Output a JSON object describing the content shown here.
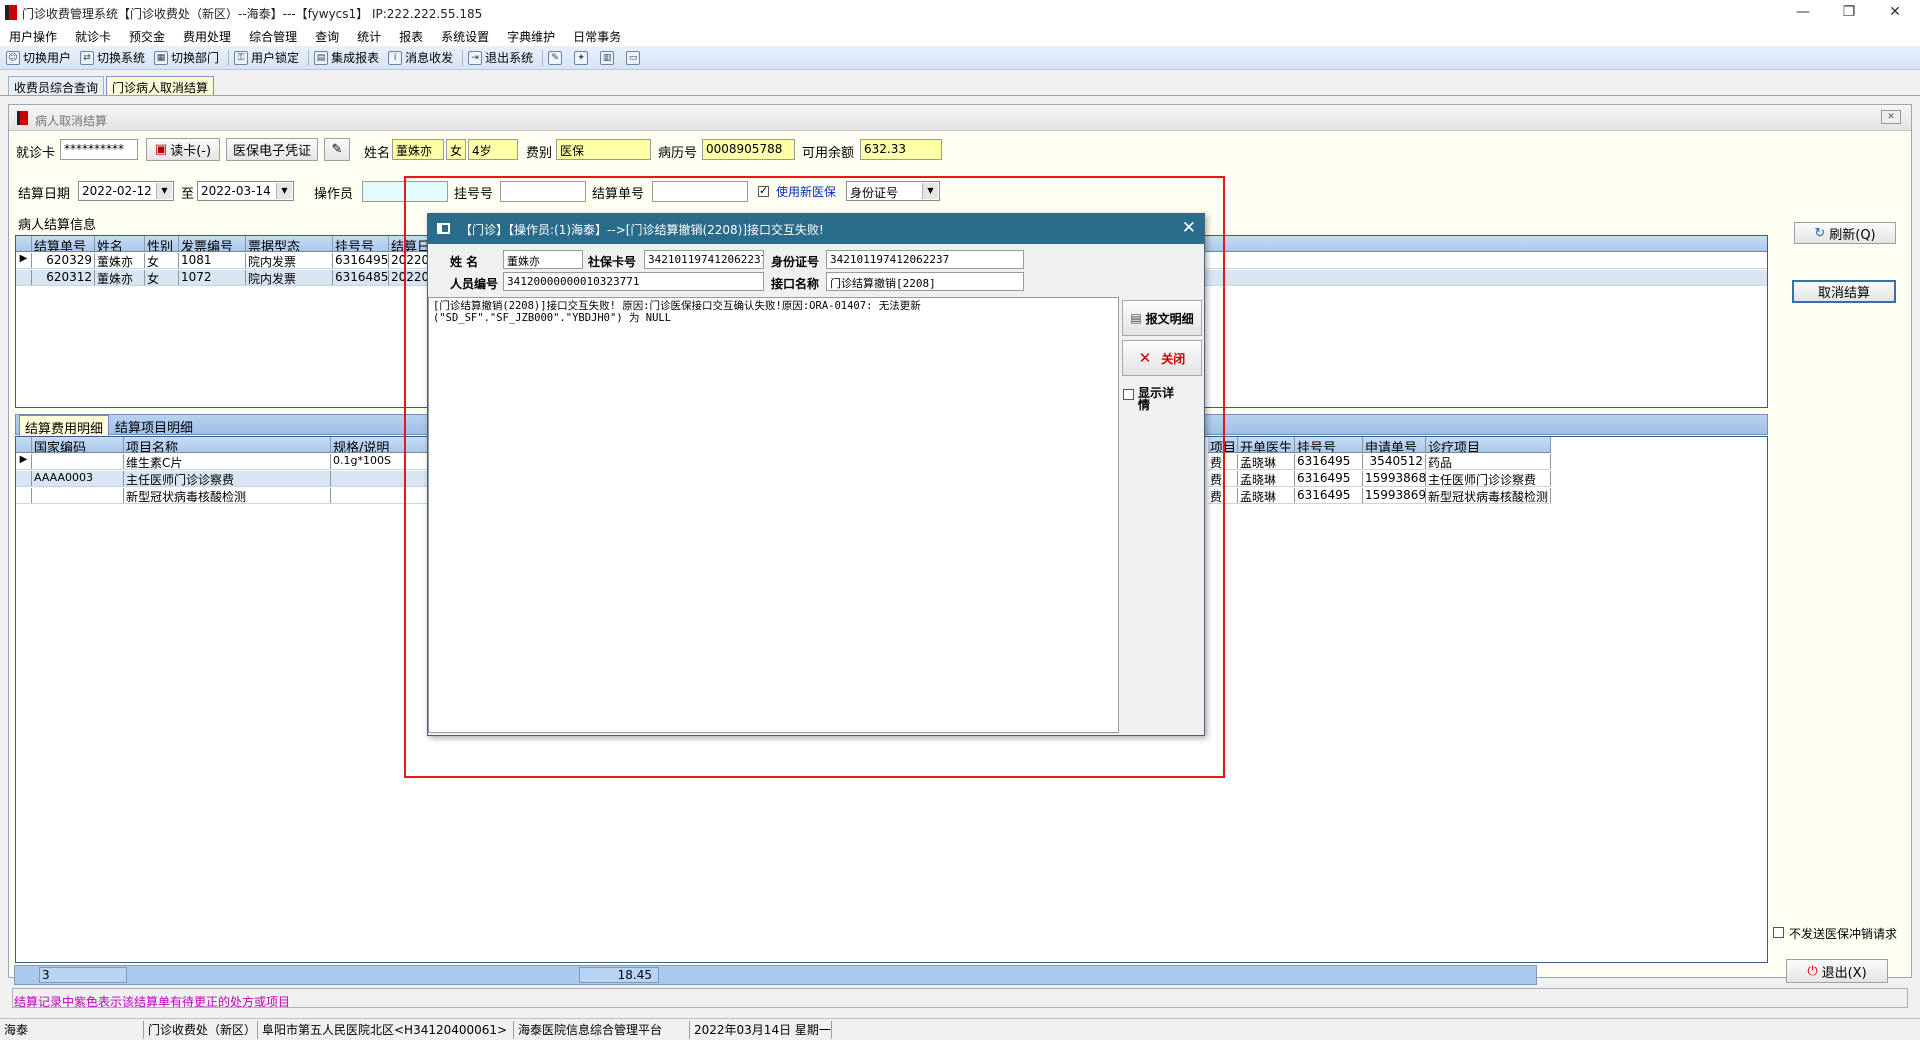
{
  "window": {
    "title": "门诊收费管理系统【门诊收费处（新区）--海泰】---【fywycs1】 IP:222.222.55.185",
    "min": "—",
    "max": "❐",
    "close": "✕"
  },
  "menu": [
    "用户操作",
    "就诊卡",
    "预交金",
    "费用处理",
    "综合管理",
    "查询",
    "统计",
    "报表",
    "系统设置",
    "字典维护",
    "日常事务"
  ],
  "toolbar": [
    "切换用户",
    "切换系统",
    "切换部门",
    "用户锁定",
    "集成报表",
    "消息收发",
    "退出系统"
  ],
  "doc_tabs": [
    "收费员综合查询",
    "门诊病人取消结算"
  ],
  "panel": {
    "title": "病人取消结算"
  },
  "patient": {
    "card_label": "就诊卡",
    "card_value": "**********",
    "read_card": "读卡(-)",
    "ins_voucher": "医保电子凭证",
    "name_label": "姓名",
    "name": "董姝亦",
    "sex": "女",
    "age": "4岁",
    "fee_type_label": "费别",
    "fee_type": "医保",
    "record_no_label": "病历号",
    "record_no": "0008905788",
    "balance_label": "可用余额",
    "balance": "632.33"
  },
  "filters": {
    "date_label": "结算日期",
    "date_from": "2022-02-12",
    "to_label": "至",
    "date_to": "2022-03-14",
    "operator_label": "操作员",
    "operator": "",
    "reg_label": "挂号号",
    "reg": "",
    "settle_label": "结算单号",
    "settle": "",
    "use_new_ins": "使用新医保",
    "id_type": "身份证号"
  },
  "settle_info": {
    "title": "病人结算信息",
    "columns": [
      "结算单号",
      "姓名",
      "性别",
      "发票编号",
      "票据型态",
      "挂号号",
      "结算日"
    ],
    "rows": [
      [
        "620329",
        "董姝亦",
        "女",
        "1081",
        "院内发票",
        "6316495",
        "20220"
      ],
      [
        "620312",
        "董姝亦",
        "女",
        "1072",
        "院内发票",
        "6316485",
        "20220"
      ]
    ]
  },
  "side": {
    "refresh": "刷新(Q)",
    "cancel_settle": "取消结算",
    "no_send": "不发送医保冲销请求",
    "exit": "退出(X)"
  },
  "detail_tabs": [
    "结算费用明细",
    "结算项目明细"
  ],
  "detail": {
    "columns": [
      "国家编码",
      "项目名称",
      "规格/说明"
    ],
    "right_columns": [
      "项目",
      "开单医生",
      "挂号号",
      "申请单号",
      "诊疗项目"
    ],
    "rows": [
      {
        "code": "",
        "name": "维生素C片",
        "spec": "0.1g*100S",
        "r": [
          "费",
          "孟晓琳",
          "6316495",
          "3540512",
          "药品"
        ]
      },
      {
        "code": "AAAA0003",
        "name": "主任医师门诊诊察费",
        "spec": "",
        "r": [
          "费",
          "孟晓琳",
          "6316495",
          "15993868",
          "主任医师门诊诊察费"
        ]
      },
      {
        "code": "",
        "name": "新型冠状病毒核酸检测",
        "spec": "",
        "r": [
          "费",
          "孟晓琳",
          "6316495",
          "15993869",
          "新型冠状病毒核酸检测"
        ]
      }
    ]
  },
  "footer": {
    "count": "3",
    "sum": "18.45"
  },
  "hint": "结算记录中紫色表示该结算单有待更正的处方或项目",
  "status": [
    "海泰",
    "门诊收费处（新区）",
    "阜阳市第五人民医院北区<H34120400061>",
    "海泰医院信息综合管理平台",
    "2022年03月14日 星期一"
  ],
  "dialog": {
    "title": "【门诊】【操作员:(1)海泰】-->[门诊结算撤销(2208)]接口交互失败!",
    "name_label": "姓    名",
    "name": "董姝亦",
    "sscard_label": "社保卡号",
    "sscard": "342101197412062237",
    "idno_label": "身份证号",
    "idno": "342101197412062237",
    "person_label": "人员编号",
    "person": "34120000000010323771",
    "iface_label": "接口名称",
    "iface": "门诊结算撤销[2208]",
    "message": "[门诊结算撤销(2208)]接口交互失败! 原因:门诊医保接口交互确认失败!原因:ORA-01407: 无法更新\n(\"SD_SF\".\"SF_JZB000\".\"YBDJH0\") 为 NULL",
    "btn_detail": "报文明细",
    "btn_close": "关闭",
    "show_detail": "显示详情"
  }
}
